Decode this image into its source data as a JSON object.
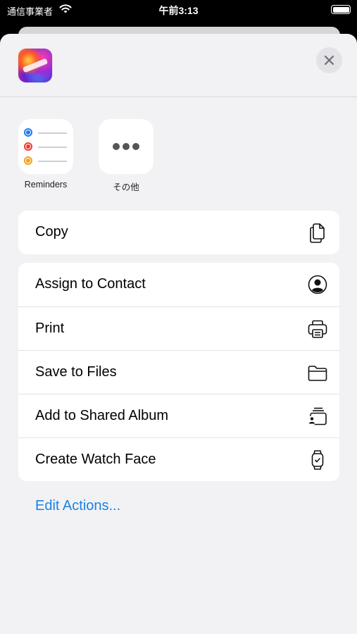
{
  "status_bar": {
    "carrier": "通信事業者",
    "time": "午前3:13"
  },
  "share_sheet": {
    "targets": [
      {
        "label": "Reminders",
        "icon": "reminders-icon"
      },
      {
        "label": "その他",
        "icon": "more-icon"
      }
    ],
    "primary_actions": [
      {
        "label": "Copy",
        "icon": "copy-icon"
      }
    ],
    "actions": [
      {
        "label": "Assign to Contact",
        "icon": "person-circle-icon"
      },
      {
        "label": "Print",
        "icon": "printer-icon"
      },
      {
        "label": "Save to Files",
        "icon": "folder-icon"
      },
      {
        "label": "Add to Shared Album",
        "icon": "shared-album-icon"
      },
      {
        "label": "Create Watch Face",
        "icon": "watch-icon"
      }
    ],
    "edit_actions_label": "Edit Actions...",
    "colors": {
      "accent": "#1a82e4",
      "sheet_background": "#f2f2f4"
    }
  }
}
